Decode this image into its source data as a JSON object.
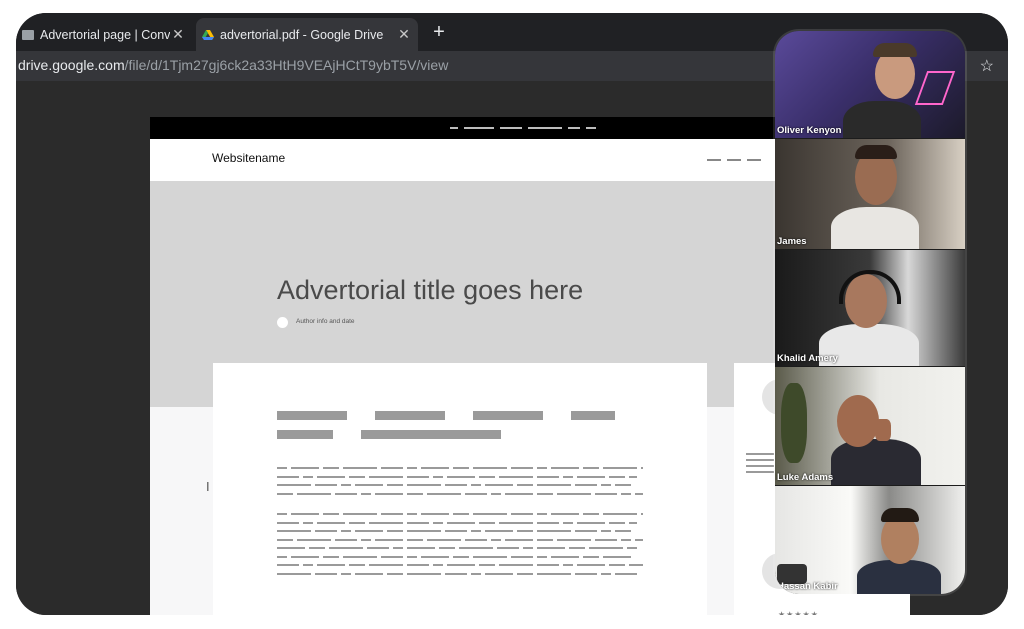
{
  "tabs": [
    {
      "title": "Advertorial page | Conve",
      "icon": "document-icon",
      "active": false
    },
    {
      "title": "advertorial.pdf - Google Drive",
      "icon": "google-drive-icon",
      "active": true
    }
  ],
  "address_bar": {
    "host": "drive.google.com",
    "path": "/file/d/1Tjm27gj6ck2a33HtH9VEAjHCtT9ybT5V/view"
  },
  "pdf": {
    "site_name": "Websitename",
    "title": "Advertorial title goes here",
    "author_info": "Author info and date"
  },
  "participants": [
    {
      "name": "Oliver Kenyon"
    },
    {
      "name": "James"
    },
    {
      "name": "Khalid Amery"
    },
    {
      "name": "Luke Adams"
    },
    {
      "name": "Hassan Kabir"
    }
  ],
  "rating_stars": "★★★★★",
  "colors": {
    "chrome_bg": "#202124",
    "toolbar_bg": "#35363a",
    "hero_gray": "#d5d5d5"
  }
}
